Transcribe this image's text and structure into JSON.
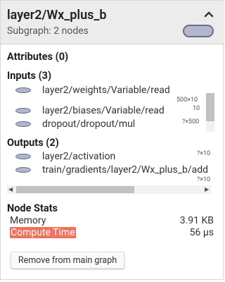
{
  "node": {
    "title": "layer2/Wx_plus_b",
    "subgraph": "Subgraph: 2 nodes"
  },
  "attributes": {
    "heading": "Attributes (0)"
  },
  "inputs": {
    "heading": "Inputs (3)",
    "items": [
      {
        "label": "layer2/weights/Variable/read",
        "shape": "500×10"
      },
      {
        "label": "layer2/biases/Variable/read",
        "shape": "10"
      },
      {
        "label": "dropout/dropout/mul",
        "shape": "?×500"
      }
    ]
  },
  "outputs": {
    "heading": "Outputs (2)",
    "items": [
      {
        "label": "layer2/activation",
        "shape": "?×10"
      },
      {
        "label": "train/gradients/layer2/Wx_plus_b/add",
        "shape": "?×10"
      }
    ]
  },
  "stats": {
    "heading": "Node Stats",
    "memory_label": "Memory",
    "memory_value": "3.91 KB",
    "compute_label": "Compute Time",
    "compute_value": "56 µs"
  },
  "actions": {
    "remove_label": "Remove from main graph"
  },
  "colors": {
    "node_fill": "#b1b7cf",
    "node_stroke": "#6c6f7d",
    "compute_highlight": "#f0725a"
  }
}
